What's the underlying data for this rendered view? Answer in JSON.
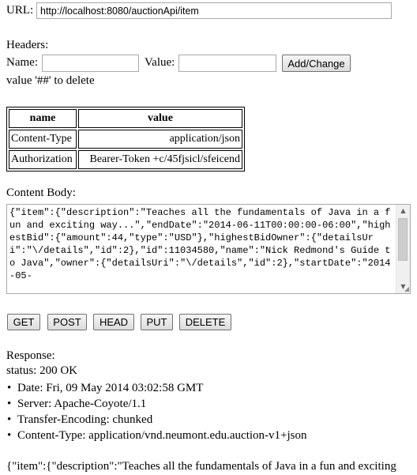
{
  "request": {
    "url_label": "URL:",
    "url_value": "http://localhost:8080/auctionApi/item"
  },
  "headers_form": {
    "title": "Headers:",
    "name_label": "Name:",
    "value_label": "Value:",
    "add_change_label": "Add/Change",
    "delete_hint": "value '##' to delete"
  },
  "headers_table": {
    "columns": [
      "name",
      "value"
    ],
    "rows": [
      {
        "name": "Content-Type",
        "value": "application/json"
      },
      {
        "name": "Authorization",
        "value": "Bearer-Token +c/45fjsicl/sfeicend"
      }
    ]
  },
  "content_body": {
    "label": "Content Body:",
    "text": "{\"item\":{\"description\":\"Teaches all the fundamentals of Java in a fun and exciting way...\",\"endDate\":\"2014-06-11T00:00:00-06:00\",\"highestBid\":{\"amount\":44,\"type\":\"USD\"},\"highestBidOwner\":{\"detailsUri\":\"\\/details\",\"id\":2},\"id\":11034580,\"name\":\"Nick Redmond's Guide to Java\",\"owner\":{\"detailsUri\":\"\\/details\",\"id\":2},\"startDate\":\"2014-05-"
  },
  "methods": {
    "get": "GET",
    "post": "POST",
    "head": "HEAD",
    "put": "PUT",
    "delete": "DELETE"
  },
  "response": {
    "label": "Response:",
    "status": "status: 200 OK",
    "headers": [
      "Date: Fri, 09 May 2014 03:02:58 GMT",
      "Server: Apache-Coyote/1.1",
      "Transfer-Encoding: chunked",
      "Content-Type: application/vnd.neumont.edu.auction-v1+json"
    ],
    "body_preview": "{\"item\":{\"description\":\"Teaches all the fundamentals of Java in a fun and exciting"
  },
  "icons": {
    "bullet": "bullet-icon",
    "scroll_up": "scroll-up-arrow-icon",
    "scroll_down": "scroll-down-arrow-icon",
    "resize": "resize-grip-icon"
  }
}
